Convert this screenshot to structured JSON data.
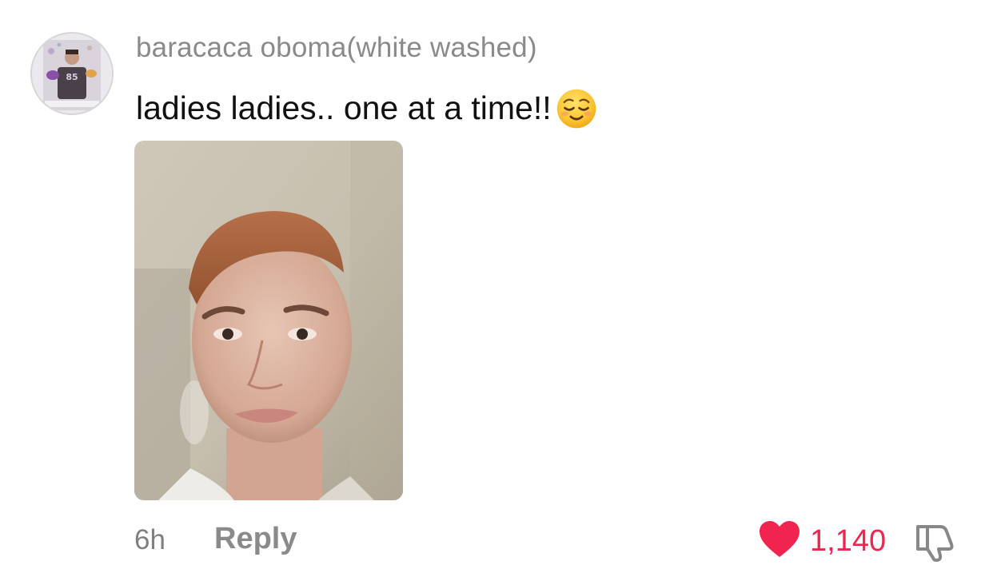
{
  "comment": {
    "avatar_icon": "user-avatar-photo",
    "username": "baracaca oboma(white washed)",
    "text": "ladies ladies.. one at a time!!",
    "emoji_icon": "relieved-face-emoji",
    "attached_image_icon": "selfie-photo",
    "timestamp": "6h",
    "reply_label": "Reply",
    "like_icon": "heart-icon",
    "like_count": "1,140",
    "dislike_icon": "thumbs-down-icon"
  },
  "colors": {
    "username": "#8a8a8a",
    "text": "#111111",
    "like": "#f0244f",
    "meta": "#8a8a8a"
  }
}
